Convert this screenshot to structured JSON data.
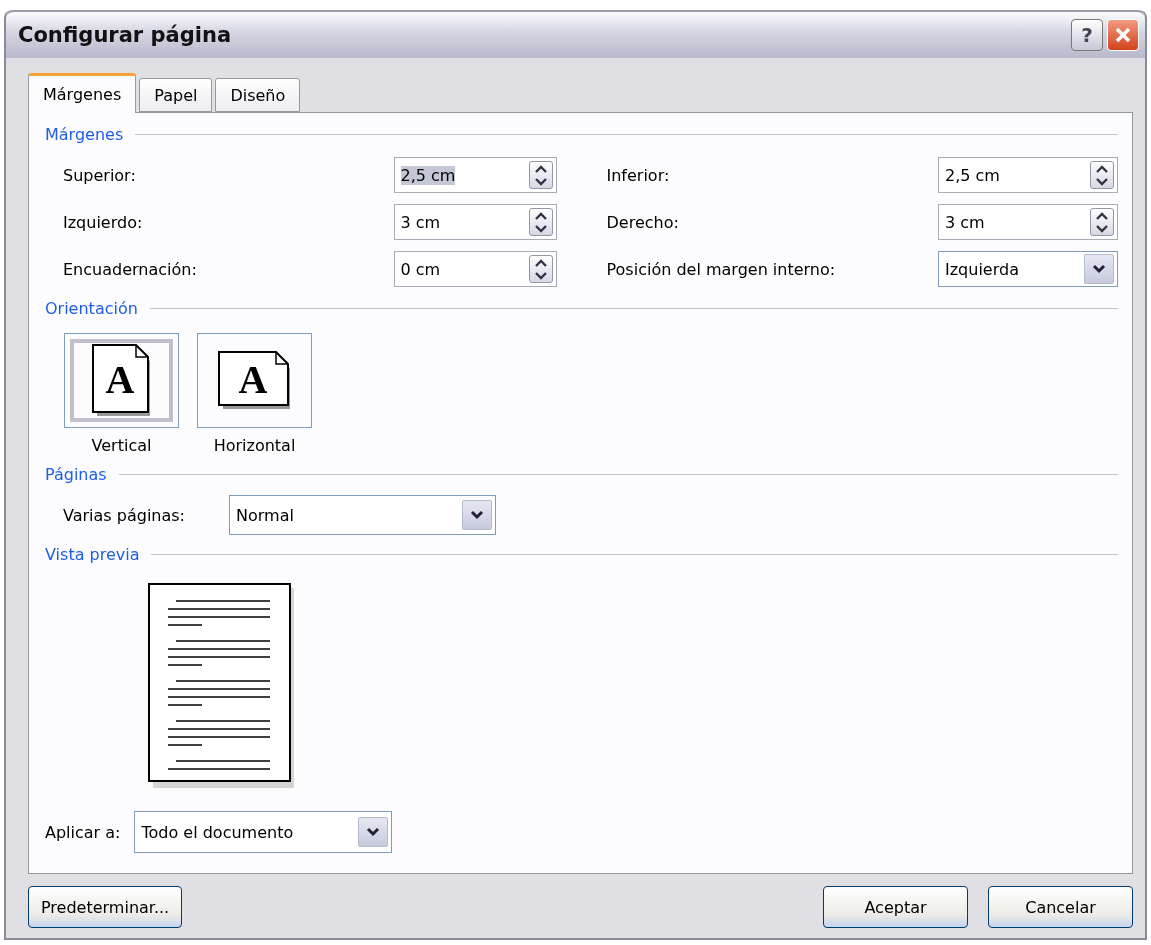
{
  "window": {
    "title": "Configurar página",
    "help_button": "?"
  },
  "tabs": [
    {
      "label": "Márgenes",
      "selected": true
    },
    {
      "label": "Papel",
      "selected": false
    },
    {
      "label": "Diseño",
      "selected": false
    }
  ],
  "margins": {
    "heading": "Márgenes",
    "fields": [
      {
        "label": "Superior:",
        "value": "2,5 cm",
        "kind": "spin",
        "text_selected": true
      },
      {
        "label": "Inferior:",
        "value": "2,5 cm",
        "kind": "spin",
        "text_selected": false
      },
      {
        "label": "Izquierdo:",
        "value": "3 cm",
        "kind": "spin",
        "text_selected": false
      },
      {
        "label": "Derecho:",
        "value": "3 cm",
        "kind": "spin",
        "text_selected": false
      },
      {
        "label": "Encuadernación:",
        "value": "0 cm",
        "kind": "spin",
        "text_selected": false
      },
      {
        "label": "Posición del margen interno:",
        "value": "Izquierda",
        "kind": "dropdown",
        "text_selected": false
      }
    ]
  },
  "orientation": {
    "heading": "Orientación",
    "options": [
      {
        "label": "Vertical",
        "kind": "portrait",
        "selected": true,
        "icon_letter": "A"
      },
      {
        "label": "Horizontal",
        "kind": "landscape",
        "selected": false,
        "icon_letter": "A"
      }
    ]
  },
  "pages": {
    "heading": "Páginas",
    "label": "Varias páginas:",
    "value": "Normal"
  },
  "preview": {
    "heading": "Vista previa",
    "apply_label": "Aplicar a:",
    "apply_value": "Todo el documento"
  },
  "buttons": [
    {
      "label": "Predeterminar..."
    },
    {
      "label": "Aceptar"
    },
    {
      "label": "Cancelar"
    }
  ]
}
